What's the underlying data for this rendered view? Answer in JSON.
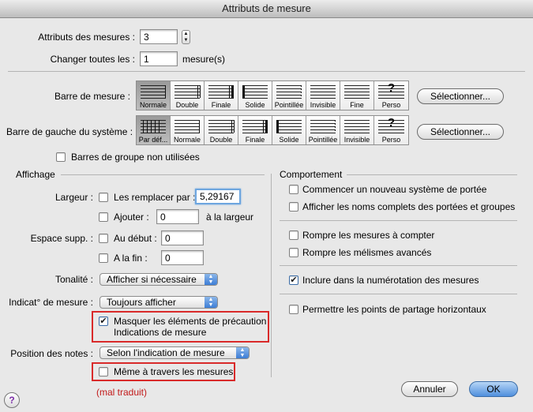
{
  "window": {
    "title": "Attributs de mesure"
  },
  "top": {
    "attrs_label": "Attributs des mesures :",
    "attrs_value": "3",
    "change_label": "Changer toutes les :",
    "change_value": "1",
    "change_unit": "mesure(s)"
  },
  "barline": {
    "label": "Barre de mesure :",
    "items": [
      "Normale",
      "Double",
      "Finale",
      "Solide",
      "Pointillée",
      "Invisible",
      "Fine",
      "Perso"
    ],
    "selected": "Normale",
    "select_button": "Sélectionner..."
  },
  "left_barline": {
    "label": "Barre de gauche du système :",
    "items": [
      "Par déf...",
      "Normale",
      "Double",
      "Finale",
      "Solide",
      "Pointillée",
      "Invisible",
      "Perso"
    ],
    "selected": "Par déf...",
    "select_button": "Sélectionner..."
  },
  "unused_group_bars": {
    "label": "Barres de groupe non utilisées",
    "checked": false
  },
  "affichage": {
    "title": "Affichage",
    "largeur_label": "Largeur :",
    "remplacer_label": "Les remplacer par :",
    "remplacer_value": "5,29167",
    "ajouter_label": "Ajouter :",
    "ajouter_value": "0",
    "ajouter_suffix": "à la largeur",
    "espace_label": "Espace supp. :",
    "debut_label": "Au début :",
    "debut_value": "0",
    "fin_label": "A la fin :",
    "fin_value": "0",
    "tonalite_label": "Tonalité :",
    "tonalite_value": "Afficher si nécessaire",
    "indicat_label": "Indicat° de mesure :",
    "indicat_value": "Toujours afficher",
    "masquer_label": "Masquer les éléments de précaution",
    "masquer_sub": "Indications de mesure",
    "masquer_checked": true,
    "position_label": "Position des notes :",
    "position_value": "Selon l'indication de mesure",
    "meme_label": "Même à travers les mesures",
    "meme_checked": false,
    "annotation": "(mal traduit)"
  },
  "comportement": {
    "title": "Comportement",
    "items": [
      {
        "label": "Commencer un nouveau système de portée",
        "checked": false
      },
      {
        "label": "Afficher les noms complets des portées et groupes",
        "checked": false
      },
      {
        "label": "Rompre les mesures à compter",
        "checked": false
      },
      {
        "label": "Rompre les mélismes avancés",
        "checked": false
      },
      {
        "label": "Inclure dans la numérotation des mesures",
        "checked": true
      },
      {
        "label": "Permettre les points de partage horizontaux",
        "checked": false
      }
    ]
  },
  "footer": {
    "cancel": "Annuler",
    "ok": "OK",
    "help": "?"
  },
  "colors": {
    "accent": "#4f8fdd",
    "highlight_box": "#d92a2a"
  }
}
